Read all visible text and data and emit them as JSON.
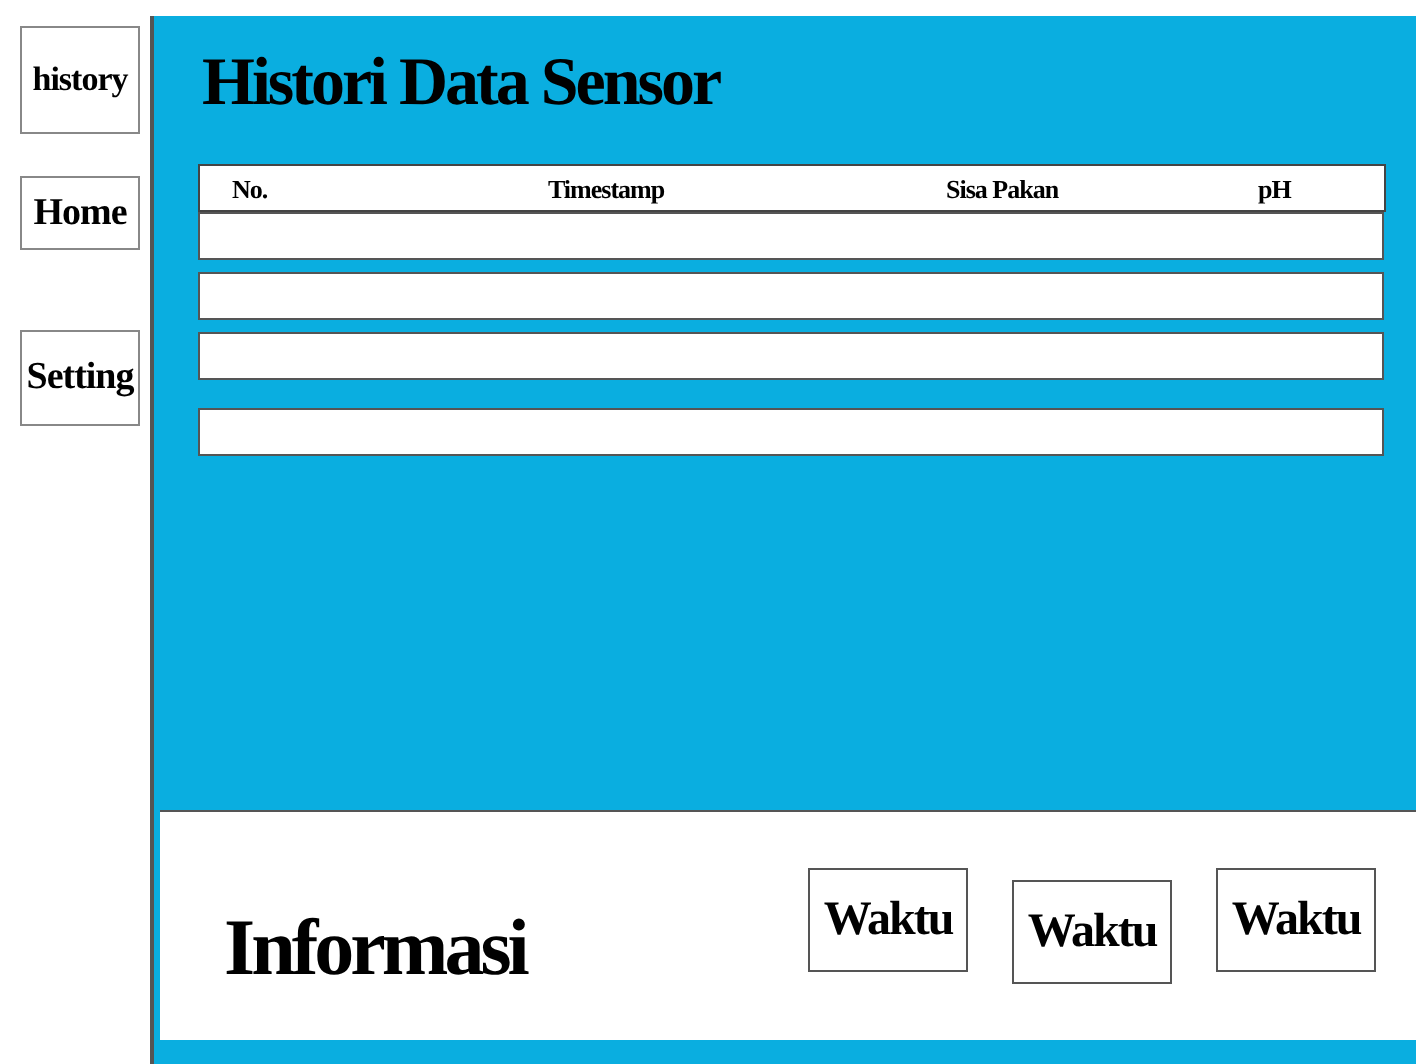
{
  "sidebar": {
    "items": [
      {
        "label": "history"
      },
      {
        "label": "Home"
      },
      {
        "label": "Setting"
      }
    ]
  },
  "title": "Histori Data Sensor",
  "table": {
    "columns": [
      "No.",
      "Timestamp",
      "Sisa Pakan",
      "pH"
    ],
    "rows": [
      {
        "kind": "blank"
      },
      {
        "kind": "blank"
      },
      {
        "kind": "blank"
      },
      {
        "kind": "blank"
      }
    ]
  },
  "info": {
    "title": "Informasi",
    "buttons": [
      "Waktu",
      "Waktu",
      "Waktu"
    ]
  }
}
